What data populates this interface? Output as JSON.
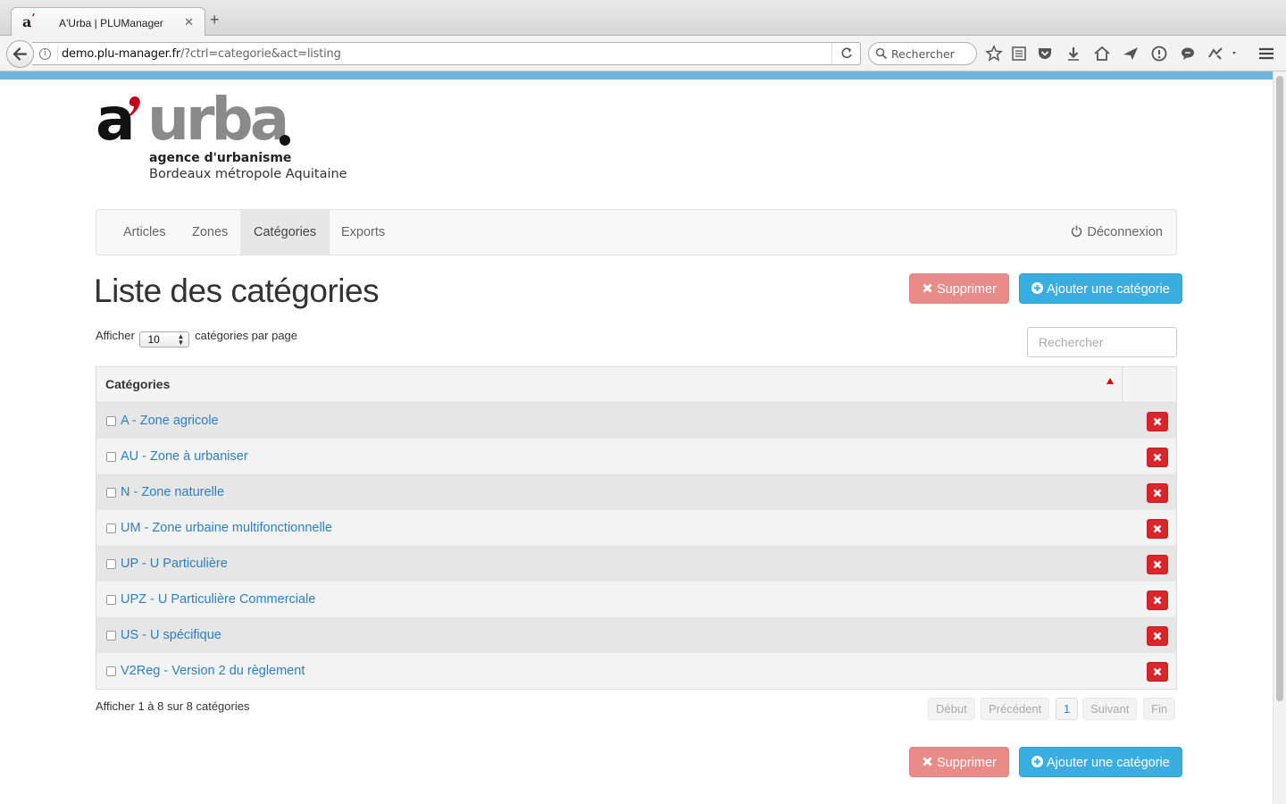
{
  "browser": {
    "tab_title": "A'Urba | PLUManager",
    "url_domain": "demo.plu-manager.fr",
    "url_path": "/?ctrl=categorie&act=listing",
    "search_placeholder": "Rechercher"
  },
  "logo": {
    "line1": "agence d'urbanisme",
    "line2": "Bordeaux métropole Aquitaine"
  },
  "nav": {
    "items": [
      {
        "label": "Articles",
        "active": false
      },
      {
        "label": "Zones",
        "active": false
      },
      {
        "label": "Catégories",
        "active": true
      },
      {
        "label": "Exports",
        "active": false
      }
    ],
    "logout": "Déconnexion"
  },
  "page": {
    "title": "Liste des catégories",
    "delete_label": "Supprimer",
    "add_label": "Ajouter une catégorie",
    "length_prefix": "Afficher",
    "length_value": "10",
    "length_suffix": "catégories par page",
    "search_placeholder": "Rechercher"
  },
  "table": {
    "header": "Catégories",
    "rows": [
      "A - Zone agricole",
      "AU - Zone à urbaniser",
      "N - Zone naturelle",
      "UM - Zone urbaine multifonctionnelle",
      "UP - U Particulière",
      "UPZ - U Particulière Commerciale",
      "US - U spécifique",
      "V2Reg - Version 2 du règlement"
    ]
  },
  "footer": {
    "info": "Afficher 1 à 8 sur 8 catégories",
    "pagination": {
      "first": "Début",
      "prev": "Précédent",
      "current": "1",
      "next": "Suivant",
      "last": "Fin"
    }
  },
  "colors": {
    "accent_bar": "#6fb3d9",
    "link": "#2a80c8",
    "danger": "#e98b88",
    "info": "#3aaee0",
    "delete_icon": "#d9262b"
  }
}
